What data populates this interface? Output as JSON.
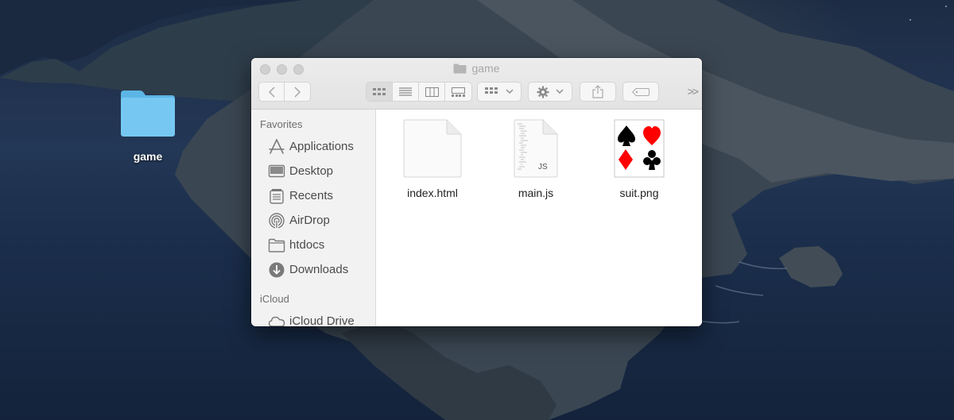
{
  "desktop": {
    "folder_label": "game"
  },
  "window": {
    "title": "game",
    "toolbar": {
      "back_icon": "chevron-left",
      "forward_icon": "chevron-right",
      "views": [
        "icon-view",
        "list-view",
        "column-view",
        "gallery-view"
      ],
      "active_view": "icon-view",
      "more_label": ">>"
    },
    "sidebar": {
      "favorites_title": "Favorites",
      "favorites": [
        {
          "label": "Applications",
          "icon": "applications-icon"
        },
        {
          "label": "Desktop",
          "icon": "desktop-icon"
        },
        {
          "label": "Recents",
          "icon": "recents-icon"
        },
        {
          "label": "AirDrop",
          "icon": "airdrop-icon"
        },
        {
          "label": "htdocs",
          "icon": "folder-icon"
        },
        {
          "label": "Downloads",
          "icon": "downloads-icon"
        }
      ],
      "icloud_title": "iCloud",
      "icloud": [
        {
          "label": "iCloud Drive",
          "icon": "cloud-icon"
        }
      ]
    },
    "files": [
      {
        "name": "index.html",
        "icon": "html-document-icon"
      },
      {
        "name": "main.js",
        "icon": "js-document-icon",
        "badge": "JS"
      },
      {
        "name": "suit.png",
        "icon": "card-suits-image-icon"
      }
    ]
  },
  "colors": {
    "folder_blue": "#6cc3f0",
    "sidebar_bg": "#f2f2f2",
    "red_suit": "#ff0000",
    "black_suit": "#000000"
  }
}
